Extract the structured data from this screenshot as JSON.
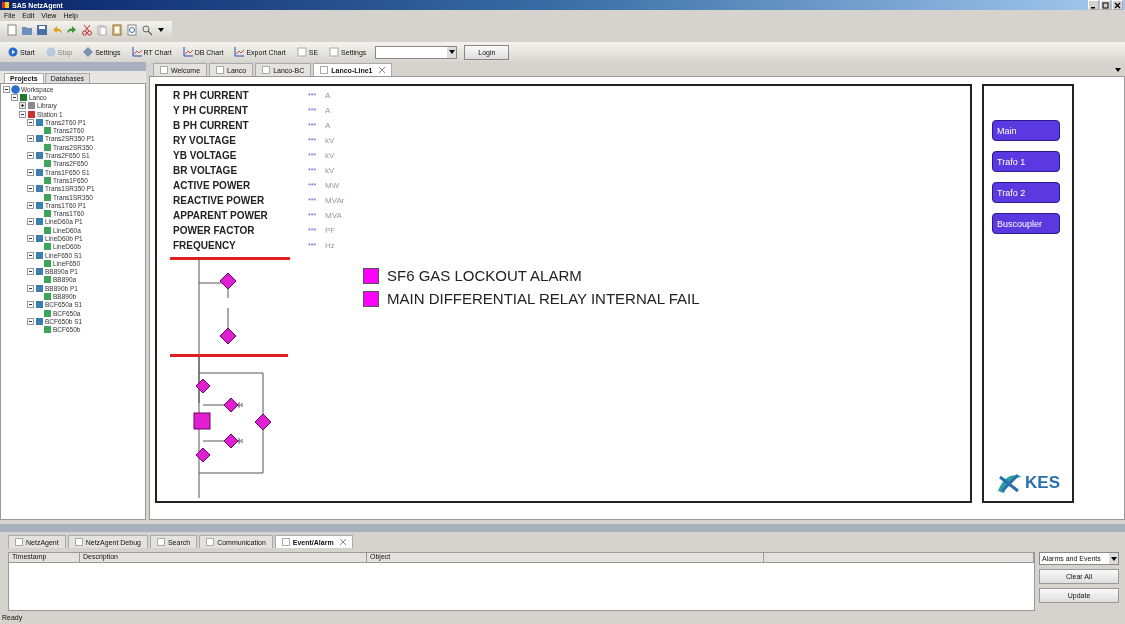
{
  "window": {
    "title": "SAS NetzAgent"
  },
  "menu": [
    "File",
    "Edit",
    "View",
    "Help"
  ],
  "toolbar_1": [
    {
      "kind": "new"
    },
    {
      "kind": "open"
    },
    {
      "kind": "save"
    },
    {
      "kind": "undo"
    },
    {
      "kind": "redo"
    },
    {
      "kind": "cut"
    },
    {
      "kind": "copy"
    },
    {
      "kind": "paste"
    },
    {
      "kind": "preview"
    },
    {
      "kind": "find"
    }
  ],
  "toolbar_2": [
    {
      "kind": "start",
      "label": "Start",
      "disabled": false
    },
    {
      "kind": "stop",
      "label": "Stop",
      "disabled": true
    },
    {
      "kind": "settings",
      "label": "Settings",
      "disabled": false
    },
    {
      "kind": "chart",
      "label": "RT Chart",
      "disabled": false
    },
    {
      "kind": "chart",
      "label": "DB Chart",
      "disabled": false
    },
    {
      "kind": "chart",
      "label": "Export Chart",
      "disabled": false
    },
    {
      "kind": "check",
      "label": "SE",
      "disabled": false
    },
    {
      "kind": "check",
      "label": "Settings",
      "disabled": false
    },
    {
      "kind": "combo",
      "disabled": false
    },
    {
      "kind": "login",
      "label": "Login",
      "disabled": false
    }
  ],
  "navigation": {
    "tabs": [
      {
        "label": "Projects",
        "selected": true
      },
      {
        "label": "Databases",
        "selected": false
      }
    ],
    "tree": [
      {
        "label": "Workspace",
        "kind": "workspace",
        "expanded": true,
        "children": [
          {
            "label": "Lanco",
            "kind": "project",
            "expanded": true,
            "children": [
              {
                "label": "Library",
                "kind": "library",
                "expanded": false
              },
              {
                "label": "Station 1",
                "kind": "station",
                "expanded": true,
                "children": [
                  {
                    "label": "Trans2T60 P1",
                    "kind": "bay",
                    "expanded": true,
                    "children": [
                      {
                        "label": "Trans2T60",
                        "kind": "device"
                      }
                    ]
                  },
                  {
                    "label": "Trans2SR350 P1",
                    "kind": "bay",
                    "expanded": true,
                    "children": [
                      {
                        "label": "Trans2SR350",
                        "kind": "device"
                      }
                    ]
                  },
                  {
                    "label": "Trans2F650 S1",
                    "kind": "bay",
                    "expanded": true,
                    "children": [
                      {
                        "label": "Trans2F650",
                        "kind": "device"
                      }
                    ]
                  },
                  {
                    "label": "Trans1F650 S1",
                    "kind": "bay",
                    "expanded": true,
                    "children": [
                      {
                        "label": "Trans1F650",
                        "kind": "device"
                      }
                    ]
                  },
                  {
                    "label": "Trans1SR350 P1",
                    "kind": "bay",
                    "expanded": true,
                    "children": [
                      {
                        "label": "Trans1SR350",
                        "kind": "device"
                      }
                    ]
                  },
                  {
                    "label": "Trans1T60 P1",
                    "kind": "bay",
                    "expanded": true,
                    "children": [
                      {
                        "label": "Trans1T60",
                        "kind": "device"
                      }
                    ]
                  },
                  {
                    "label": "LineD60a P1",
                    "kind": "bay",
                    "expanded": true,
                    "children": [
                      {
                        "label": "LineD60a",
                        "kind": "device"
                      }
                    ]
                  },
                  {
                    "label": "LineD60b P1",
                    "kind": "bay",
                    "expanded": true,
                    "children": [
                      {
                        "label": "LineD60b",
                        "kind": "device"
                      }
                    ]
                  },
                  {
                    "label": "LineF650 S1",
                    "kind": "bay",
                    "expanded": true,
                    "children": [
                      {
                        "label": "LineF650",
                        "kind": "device"
                      }
                    ]
                  },
                  {
                    "label": "BB890a P1",
                    "kind": "bay",
                    "expanded": true,
                    "children": [
                      {
                        "label": "BB890a",
                        "kind": "device"
                      }
                    ]
                  },
                  {
                    "label": "BB890b P1",
                    "kind": "bay",
                    "expanded": true,
                    "children": [
                      {
                        "label": "BB890b",
                        "kind": "device"
                      }
                    ]
                  },
                  {
                    "label": "BCF650a S1",
                    "kind": "bay",
                    "expanded": true,
                    "children": [
                      {
                        "label": "BCF650a",
                        "kind": "device"
                      }
                    ]
                  },
                  {
                    "label": "BCF650b S1",
                    "kind": "bay",
                    "expanded": true,
                    "children": [
                      {
                        "label": "BCF650b",
                        "kind": "device"
                      }
                    ]
                  }
                ]
              }
            ]
          }
        ]
      }
    ]
  },
  "document_tabs": [
    {
      "label": "Welcome",
      "selected": false
    },
    {
      "label": "Lanco",
      "selected": false
    },
    {
      "label": "Lanco-BC",
      "selected": false
    },
    {
      "label": "Lanco-Line1",
      "selected": true
    }
  ],
  "measurements": [
    {
      "label": "R PH CURRENT",
      "value": "***",
      "unit": "A"
    },
    {
      "label": "Y PH CURRENT",
      "value": "***",
      "unit": "A"
    },
    {
      "label": "B PH CURRENT",
      "value": "***",
      "unit": "A"
    },
    {
      "label": "RY VOLTAGE",
      "value": "***",
      "unit": "kV"
    },
    {
      "label": "YB VOLTAGE",
      "value": "***",
      "unit": "kV"
    },
    {
      "label": "BR VOLTAGE",
      "value": "***",
      "unit": "kV"
    },
    {
      "label": "ACTIVE POWER",
      "value": "***",
      "unit": "MW"
    },
    {
      "label": "REACTIVE POWER",
      "value": "***",
      "unit": "MVAr"
    },
    {
      "label": "APPARENT POWER",
      "value": "***",
      "unit": "MVA"
    },
    {
      "label": "POWER FACTOR",
      "value": "***",
      "unit": "PF"
    },
    {
      "label": "FREQUENCY",
      "value": "***",
      "unit": "Hz"
    }
  ],
  "alarms": [
    {
      "label": "SF6 GAS LOCKOUT ALARM",
      "active": true
    },
    {
      "label": "MAIN DIFFERENTIAL RELAY INTERNAL FAIL",
      "active": true
    }
  ],
  "screen_buttons": [
    "Main",
    "Trafo 1",
    "Trafo 2",
    "Buscoupler"
  ],
  "logo": {
    "text": "KES"
  },
  "bottom_tabs": [
    {
      "label": "NetzAgent",
      "selected": false
    },
    {
      "label": "NetzAgent Debug",
      "selected": false
    },
    {
      "label": "Search",
      "selected": false
    },
    {
      "label": "Communication",
      "selected": false
    },
    {
      "label": "Event/Alarm",
      "selected": true
    }
  ],
  "event_table": {
    "columns": [
      "Timestamp",
      "Description",
      "Object"
    ]
  },
  "event_filter": {
    "value": "Alarms and Events"
  },
  "event_buttons": [
    "Clear All",
    "Update"
  ],
  "status_bar": "Ready"
}
